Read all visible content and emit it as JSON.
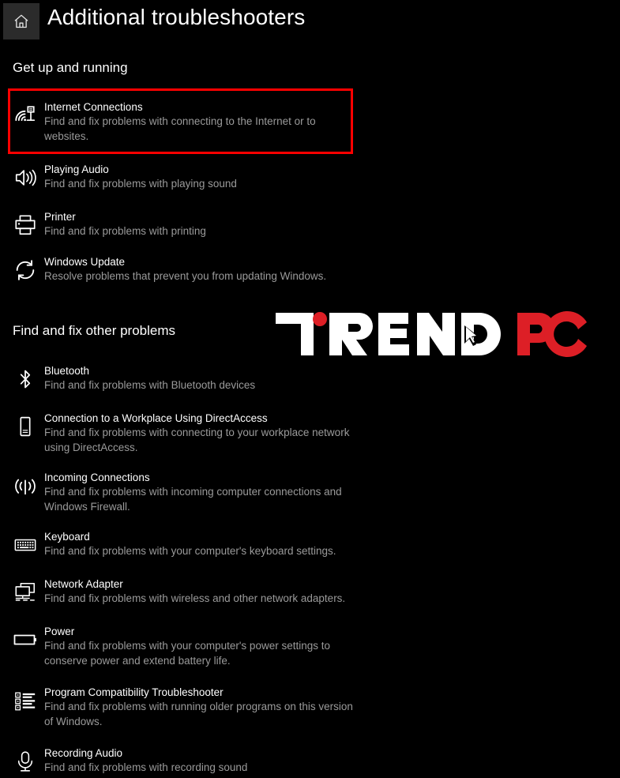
{
  "header": {
    "home_icon": "home-icon",
    "title": "Additional troubleshooters"
  },
  "sections": [
    {
      "heading": "Get up and running",
      "items": [
        {
          "icon": "internet-connections-icon",
          "title": "Internet Connections",
          "description": "Find and fix problems with connecting to the Internet or to websites.",
          "highlighted": true
        },
        {
          "icon": "speaker-icon",
          "title": "Playing Audio",
          "description": "Find and fix problems with playing sound",
          "highlighted": false
        },
        {
          "icon": "printer-icon",
          "title": "Printer",
          "description": "Find and fix problems with printing",
          "highlighted": false
        },
        {
          "icon": "refresh-icon",
          "title": "Windows Update",
          "description": "Resolve problems that prevent you from updating Windows.",
          "highlighted": false
        }
      ]
    },
    {
      "heading": "Find and fix other problems",
      "items": [
        {
          "icon": "bluetooth-icon",
          "title": "Bluetooth",
          "description": "Find and fix problems with Bluetooth devices",
          "highlighted": false
        },
        {
          "icon": "workplace-device-icon",
          "title": "Connection to a Workplace Using DirectAccess",
          "description": "Find and fix problems with connecting to your workplace network using DirectAccess.",
          "highlighted": false
        },
        {
          "icon": "incoming-connections-icon",
          "title": "Incoming Connections",
          "description": "Find and fix problems with incoming computer connections and Windows Firewall.",
          "highlighted": false
        },
        {
          "icon": "keyboard-icon",
          "title": "Keyboard",
          "description": "Find and fix problems with your computer's keyboard settings.",
          "highlighted": false
        },
        {
          "icon": "network-adapter-icon",
          "title": "Network Adapter",
          "description": "Find and fix problems with wireless and other network adapters.",
          "highlighted": false
        },
        {
          "icon": "battery-icon",
          "title": "Power",
          "description": "Find and fix problems with your computer's power settings to conserve power and extend battery life.",
          "highlighted": false
        },
        {
          "icon": "list-icon",
          "title": "Program Compatibility Troubleshooter",
          "description": "Find and fix problems with running older programs on this version of Windows.",
          "highlighted": false
        },
        {
          "icon": "microphone-icon",
          "title": "Recording Audio",
          "description": "Find and fix problems with recording sound",
          "highlighted": false
        }
      ]
    }
  ],
  "watermark": {
    "text_white": "TREND",
    "text_red": "PC",
    "accent_red": "#dd1f26",
    "cursor_icon": "cursor-arrow-icon",
    "dot_icon": "red-dot-icon"
  },
  "highlight": {
    "color": "#ff0000",
    "target": "Internet Connections"
  },
  "positions": {
    "item_tops": [
      126,
      205,
      265,
      322,
      460,
      520,
      595,
      670,
      730,
      790,
      867,
      944
    ]
  }
}
